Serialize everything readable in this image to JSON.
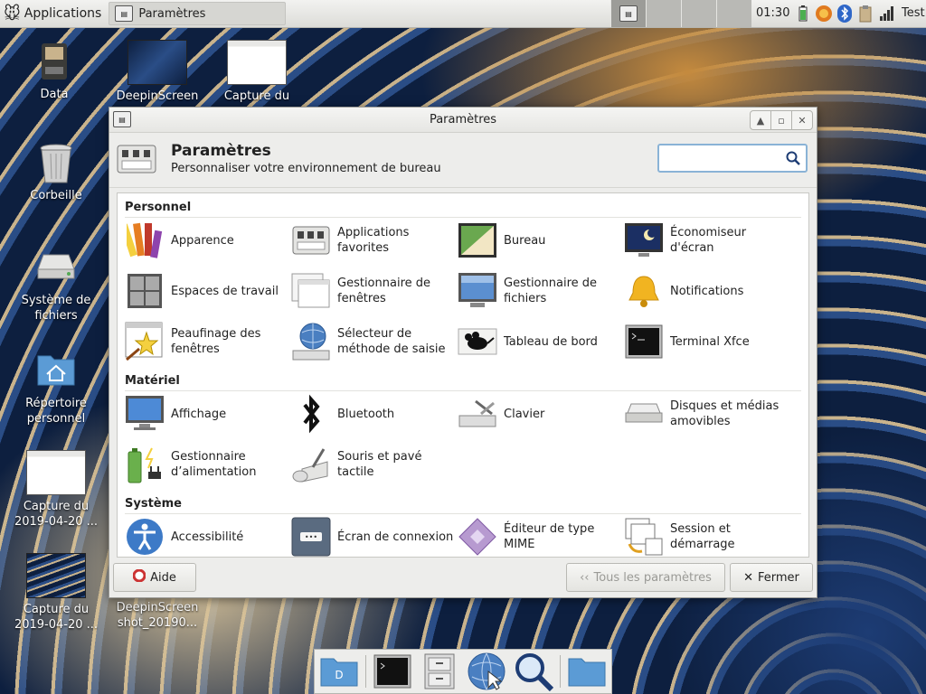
{
  "panel": {
    "applications_label": "Applications",
    "task_label": "Paramètres",
    "clock": "01:30",
    "user": "Test"
  },
  "desktop": {
    "icons": [
      {
        "label": "Data"
      },
      {
        "label": "DeepinScreen"
      },
      {
        "label": "Capture du"
      },
      {
        "label": "Corbeille"
      },
      {
        "label": "Système de fichiers"
      },
      {
        "label": "Répertoire personnel"
      },
      {
        "label": "Capture du 2019-04-20 ..."
      },
      {
        "label": "Capture du 2019-04-20 ..."
      },
      {
        "label": "DeepinScreen shot_20190..."
      }
    ]
  },
  "window": {
    "title": "Paramètres",
    "header_title": "Paramètres",
    "header_subtitle": "Personnaliser votre environnement de bureau",
    "search_placeholder": "",
    "categories": [
      {
        "title": "Personnel",
        "items": [
          {
            "label": "Apparence"
          },
          {
            "label": "Applications favorites"
          },
          {
            "label": "Bureau"
          },
          {
            "label": "Économiseur d'écran"
          },
          {
            "label": "Espaces de travail"
          },
          {
            "label": "Gestionnaire de fenêtres"
          },
          {
            "label": "Gestionnaire de fichiers"
          },
          {
            "label": "Notifications"
          },
          {
            "label": "Peaufinage des fenêtres"
          },
          {
            "label": "Sélecteur de méthode de saisie"
          },
          {
            "label": "Tableau de bord"
          },
          {
            "label": "Terminal Xfce"
          }
        ]
      },
      {
        "title": "Matériel",
        "items": [
          {
            "label": "Affichage"
          },
          {
            "label": "Bluetooth"
          },
          {
            "label": "Clavier"
          },
          {
            "label": "Disques et médias amovibles"
          },
          {
            "label": "Gestionnaire d’alimentation"
          },
          {
            "label": "Souris et pavé tactile"
          }
        ]
      },
      {
        "title": "Système",
        "items": [
          {
            "label": "Accessibilité"
          },
          {
            "label": "Écran de connexion"
          },
          {
            "label": "Éditeur de type MIME"
          },
          {
            "label": "Session et démarrage"
          }
        ]
      }
    ],
    "buttons": {
      "help": "Aide",
      "all_settings": "Tous les paramètres",
      "close": "Fermer"
    }
  },
  "colors": {
    "panel_bg": "#dcdcd8",
    "window_bg": "#ededeb",
    "accent": "#8ab3d6"
  }
}
